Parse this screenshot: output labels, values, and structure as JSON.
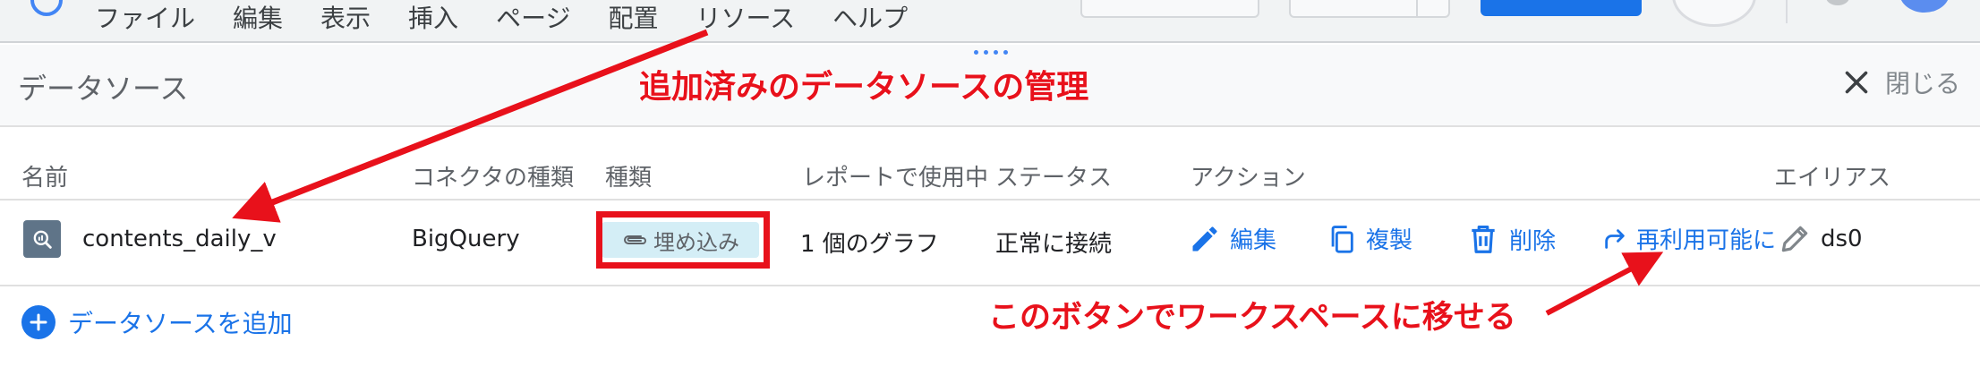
{
  "menu": {
    "items": [
      "ファイル",
      "編集",
      "表示",
      "挿入",
      "ページ",
      "配置",
      "リソース",
      "ヘルプ"
    ]
  },
  "panel": {
    "title": "データソース",
    "close_label": "閉じる"
  },
  "table": {
    "headers": {
      "name": "名前",
      "connector": "コネクタの種類",
      "type": "種類",
      "used_in_report": "レポートで使用中",
      "status": "ステータス",
      "actions": "アクション",
      "alias": "エイリアス"
    },
    "row": {
      "name": "contents_daily_v",
      "connector": "BigQuery",
      "type_chip": "埋め込み",
      "used_in_report": "1 個のグラフ",
      "status": "正常に接続",
      "alias": "ds0",
      "actions": {
        "edit": "編集",
        "duplicate": "複製",
        "delete": "削除",
        "make_reusable": "再利用可能に"
      }
    }
  },
  "add_data_source_label": "データソースを追加",
  "annotations": {
    "managed_sources": "追加済みのデータソースの管理",
    "move_to_workspace": "このボタンでワークスペースに移せる"
  },
  "colors": {
    "accent": "#1a73e8",
    "annotation": "#e8111b",
    "chip_background": "#d4eef6"
  }
}
